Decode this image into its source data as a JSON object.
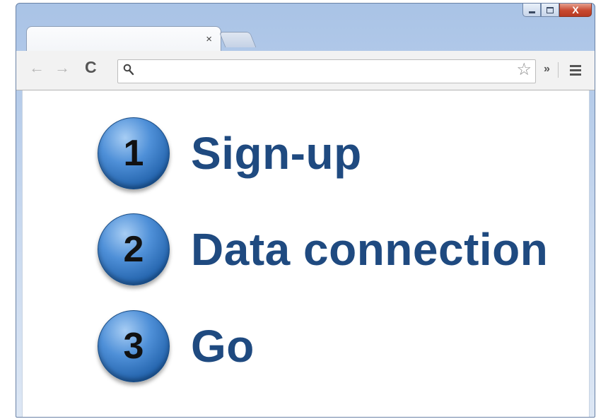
{
  "window": {
    "controls": {
      "minimize": "minimize",
      "maximize": "maximize",
      "close": "X"
    }
  },
  "tabs": [
    {
      "title": "",
      "close_label": "×"
    }
  ],
  "toolbar": {
    "back_icon": "←",
    "forward_icon": "→",
    "reload_icon": "C",
    "omnibox": {
      "value": "",
      "placeholder": ""
    },
    "star_icon": "☆",
    "overflow_label": "»"
  },
  "steps": [
    {
      "number": "1",
      "label": "Sign-up"
    },
    {
      "number": "2",
      "label": "Data connection"
    },
    {
      "number": "3",
      "label": "Go"
    }
  ],
  "colors": {
    "step_text": "#1f4a80",
    "step_circle": "#3a78c2"
  }
}
